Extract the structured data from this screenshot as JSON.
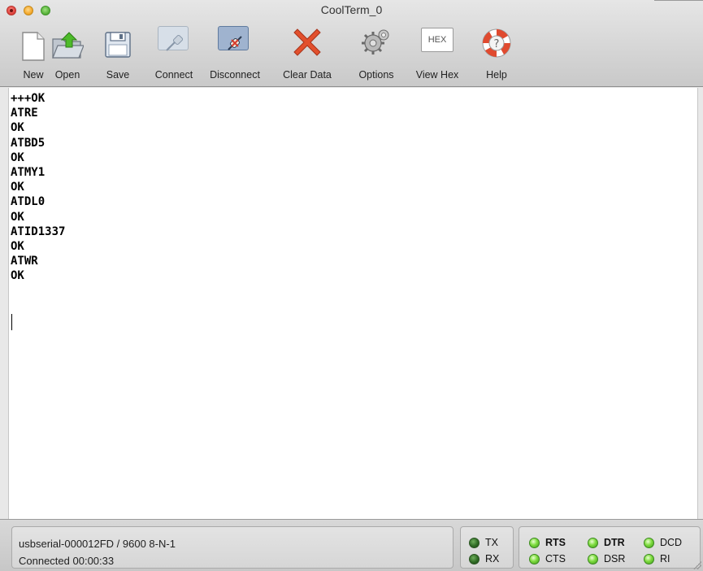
{
  "window": {
    "title": "CoolTerm_0"
  },
  "toolbar": {
    "new_label": "New",
    "open_label": "Open",
    "save_label": "Save",
    "connect_label": "Connect",
    "disconnect_label": "Disconnect",
    "clear_label": "Clear Data",
    "options_label": "Options",
    "viewhex_label": "View Hex",
    "viewhex_icon_text": "HEX",
    "help_label": "Help"
  },
  "terminal": {
    "lines": [
      "+++OK",
      "ATRE",
      "OK",
      "ATBD5",
      "OK",
      "ATMY1",
      "OK",
      "ATDL0",
      "OK",
      "ATID1337",
      "OK",
      "ATWR",
      "OK"
    ]
  },
  "status": {
    "port": "usbserial-000012FD / 9600 8-N-1",
    "connection": "Connected 00:00:33",
    "leds": {
      "tx": "TX",
      "rx": "RX",
      "rts": "RTS",
      "cts": "CTS",
      "dtr": "DTR",
      "dsr": "DSR",
      "dcd": "DCD",
      "ri": "RI"
    }
  },
  "colors": {
    "led_active": "#7fdc3f",
    "led_dim": "#2f6b25",
    "clear_icon": "#e2502d",
    "open_arrow": "#4dbb2a"
  }
}
